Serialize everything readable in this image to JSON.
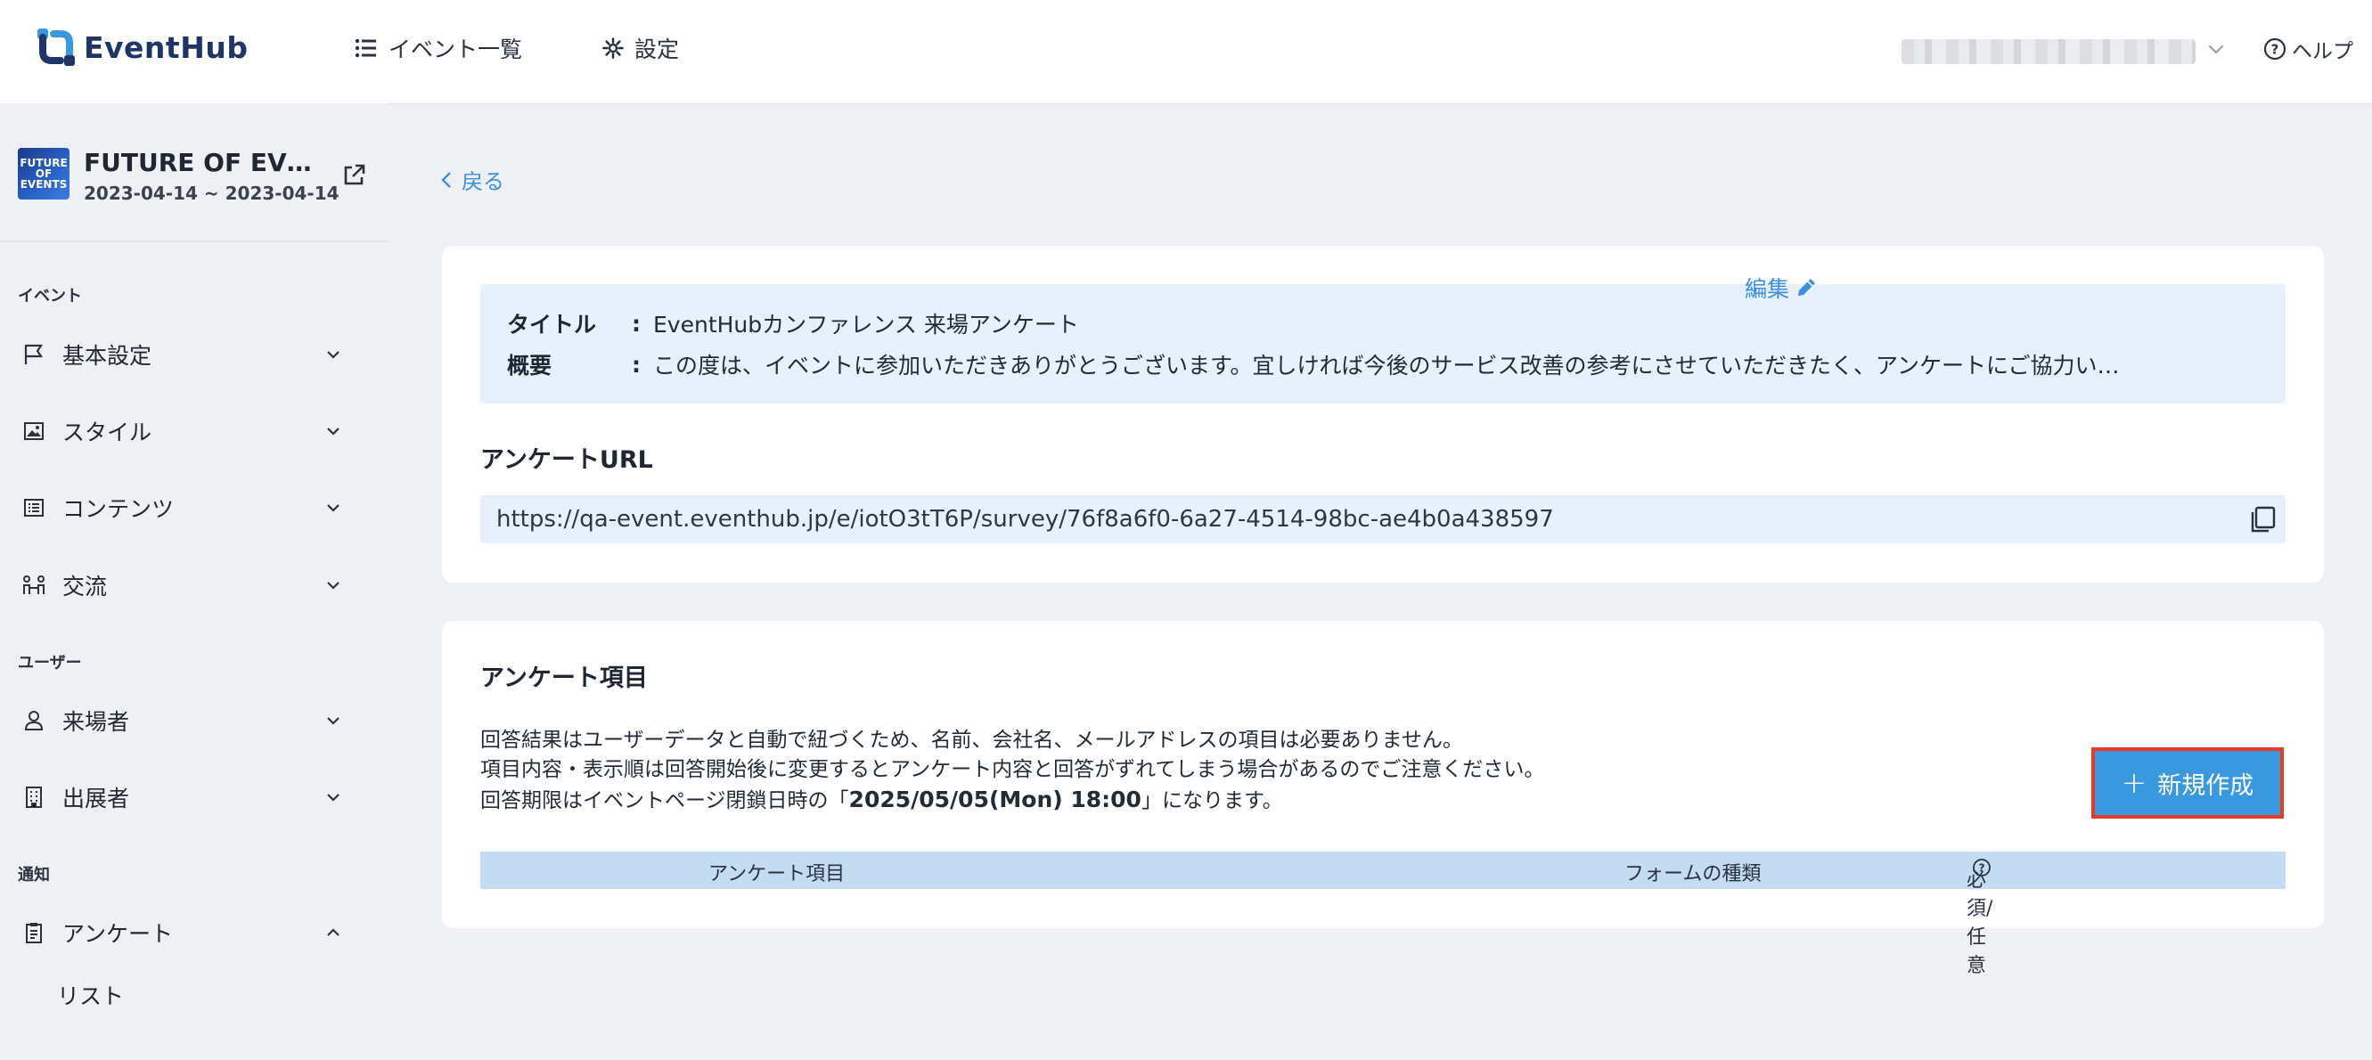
{
  "header": {
    "logo_text": "EventHub",
    "nav": [
      {
        "label": "イベント一覧",
        "icon": "list-icon"
      },
      {
        "label": "設定",
        "icon": "gear-icon"
      }
    ],
    "help_label": "ヘルプ"
  },
  "sidebar": {
    "event_name": "FUTURE OF EVEN…",
    "event_dates": "2023-04-14 ~ 2023-04-14",
    "thumb_text": "FUTURE OF EVENTS",
    "sections": {
      "event": "イベント",
      "user": "ユーザー",
      "notify": "通知"
    },
    "items": [
      {
        "label": "基本設定",
        "icon": "flag-icon"
      },
      {
        "label": "スタイル",
        "icon": "image-icon"
      },
      {
        "label": "コンテンツ",
        "icon": "list-box-icon"
      },
      {
        "label": "交流",
        "icon": "networking-icon"
      },
      {
        "label": "来場者",
        "icon": "person-icon"
      },
      {
        "label": "出展者",
        "icon": "building-icon"
      },
      {
        "label": "アンケート",
        "icon": "clipboard-icon"
      }
    ],
    "sub_items": [
      {
        "label": "リスト"
      }
    ]
  },
  "main": {
    "back_label": "戻る",
    "info": {
      "title_key": "タイトル",
      "title_value": "EventHubカンファレンス 来場アンケート",
      "summary_key": "概要",
      "summary_value": "この度は、イベントに参加いただきありがとうございます。宜しければ今後のサービス改善の参考にさせていただきたく、アンケートにご協力い…",
      "colon": ":",
      "edit_label": "編集"
    },
    "url_section_title": "アンケートURL",
    "survey_url": "https://qa-event.eventhub.jp/e/iotO3tT6P/survey/76f8a6f0-6a27-4514-98bc-ae4b0a438597",
    "items_section_title": "アンケート項目",
    "description": {
      "line1": "回答結果はユーザーデータと自動で紐づくため、名前、会社名、メールアドレスの項目は必要ありません。",
      "line2": "項目内容・表示順は回答開始後に変更するとアンケート内容と回答がずれてしまう場合があるのでご注意ください。",
      "line3_prefix": "回答期限はイベントページ閉鎖日時の「",
      "line3_deadline": "2025/05/05(Mon) 18:00",
      "line3_suffix": "」になります。"
    },
    "new_button_label": "新規作成",
    "table_headers": {
      "item": "アンケート項目",
      "form_type": "フォームの種類",
      "required": "必須/任意"
    }
  },
  "colors": {
    "accent": "#3a98de",
    "link": "#3b8fdf",
    "highlight_border": "#e83a27",
    "info_bg": "#e6f1fb",
    "table_header_bg": "#c3dcf2"
  }
}
